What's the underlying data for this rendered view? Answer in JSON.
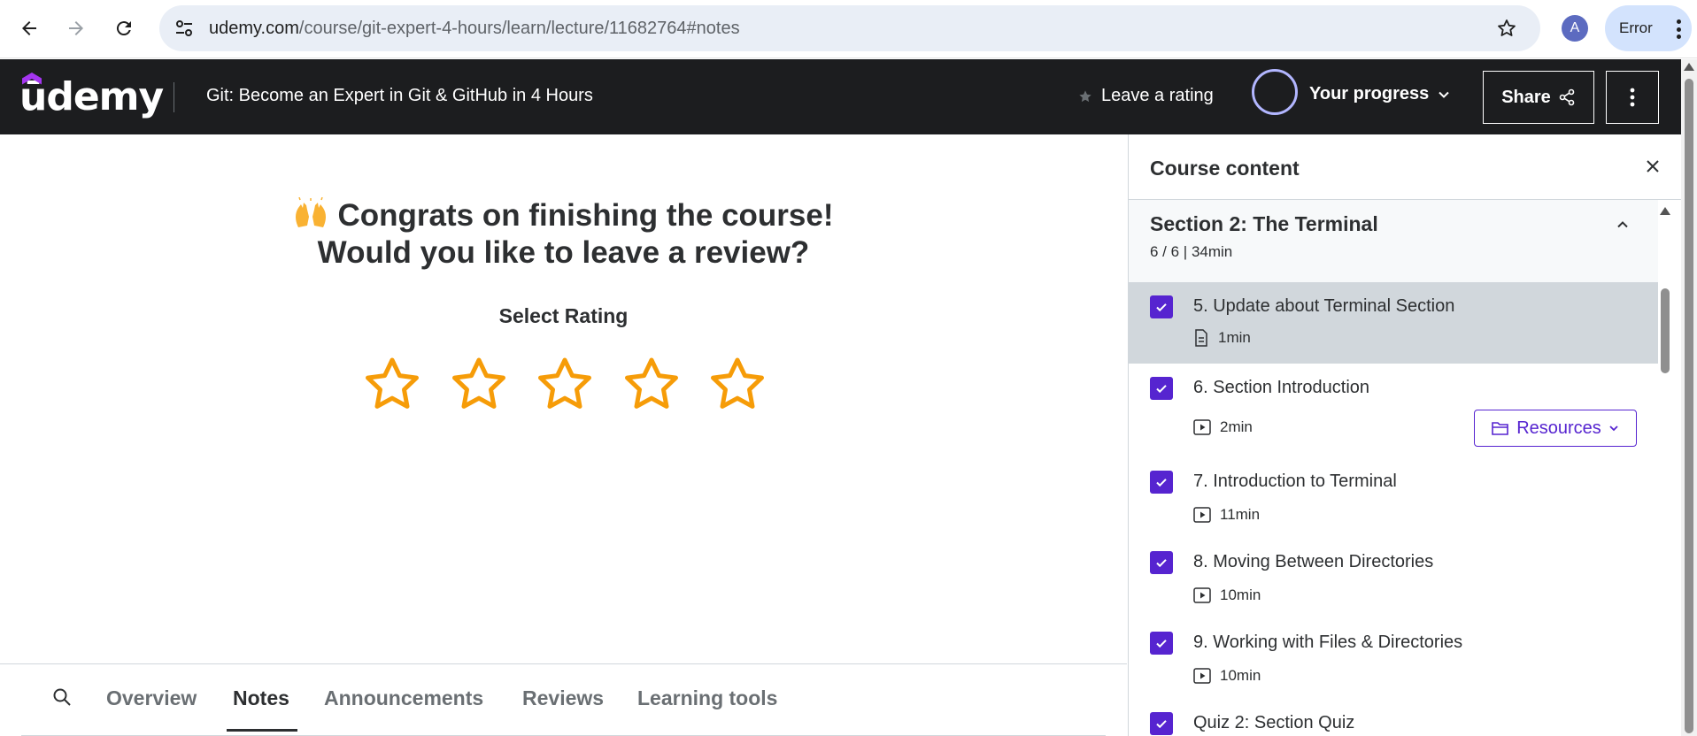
{
  "browser": {
    "url_host": "udemy.com",
    "url_path": "/course/git-expert-4-hours/learn/lecture/11682764#notes",
    "profile_initial": "A",
    "error_label": "Error",
    "icons": {
      "back": "back-arrow-icon",
      "forward": "forward-arrow-icon",
      "reload": "reload-icon",
      "site_info": "tune-icon",
      "bookmark": "star-outline-icon",
      "menu": "kebab-menu-icon"
    }
  },
  "header": {
    "logo": "udemy",
    "course_title": "Git: Become an Expert in Git & GitHub in 4 Hours",
    "leave_rating": "Leave a rating",
    "your_progress": "Your progress",
    "share": "Share",
    "colors": {
      "background": "#1c1d1f",
      "text": "#ffffff",
      "progress_ring": "#b2b6ff"
    }
  },
  "main": {
    "congrats_line1": "Congrats on finishing the course!",
    "congrats_line2": "Would you like to leave a review?",
    "select_rating": "Select Rating",
    "rating": {
      "stars_total": 5,
      "stars_selected": 0,
      "star_color": "#f69c08"
    },
    "tabs": [
      {
        "label": "Overview",
        "active": false
      },
      {
        "label": "Notes",
        "active": true
      },
      {
        "label": "Announcements",
        "active": false
      },
      {
        "label": "Reviews",
        "active": false
      },
      {
        "label": "Learning tools",
        "active": false
      }
    ]
  },
  "sidebar": {
    "title": "Course content",
    "section": {
      "title": "Section 2: The Terminal",
      "meta": "6 / 6 | 34min",
      "expanded": true
    },
    "items": [
      {
        "title": "5. Update about Terminal Section",
        "duration": "1min",
        "type": "article",
        "completed": true,
        "current": true
      },
      {
        "title": "6. Section Introduction",
        "duration": "2min",
        "type": "video",
        "completed": true,
        "current": false,
        "resources": "Resources"
      },
      {
        "title": "7. Introduction to Terminal",
        "duration": "11min",
        "type": "video",
        "completed": true,
        "current": false
      },
      {
        "title": "8. Moving Between Directories",
        "duration": "10min",
        "type": "video",
        "completed": true,
        "current": false
      },
      {
        "title": "9. Working with Files & Directories",
        "duration": "10min",
        "type": "video",
        "completed": true,
        "current": false
      },
      {
        "title": "Quiz 2: Section Quiz",
        "completed": true,
        "current": false
      }
    ],
    "colors": {
      "checkbox": "#5624d0",
      "current_row": "#d1d7dc",
      "section_bg": "#f7f9fa"
    }
  }
}
